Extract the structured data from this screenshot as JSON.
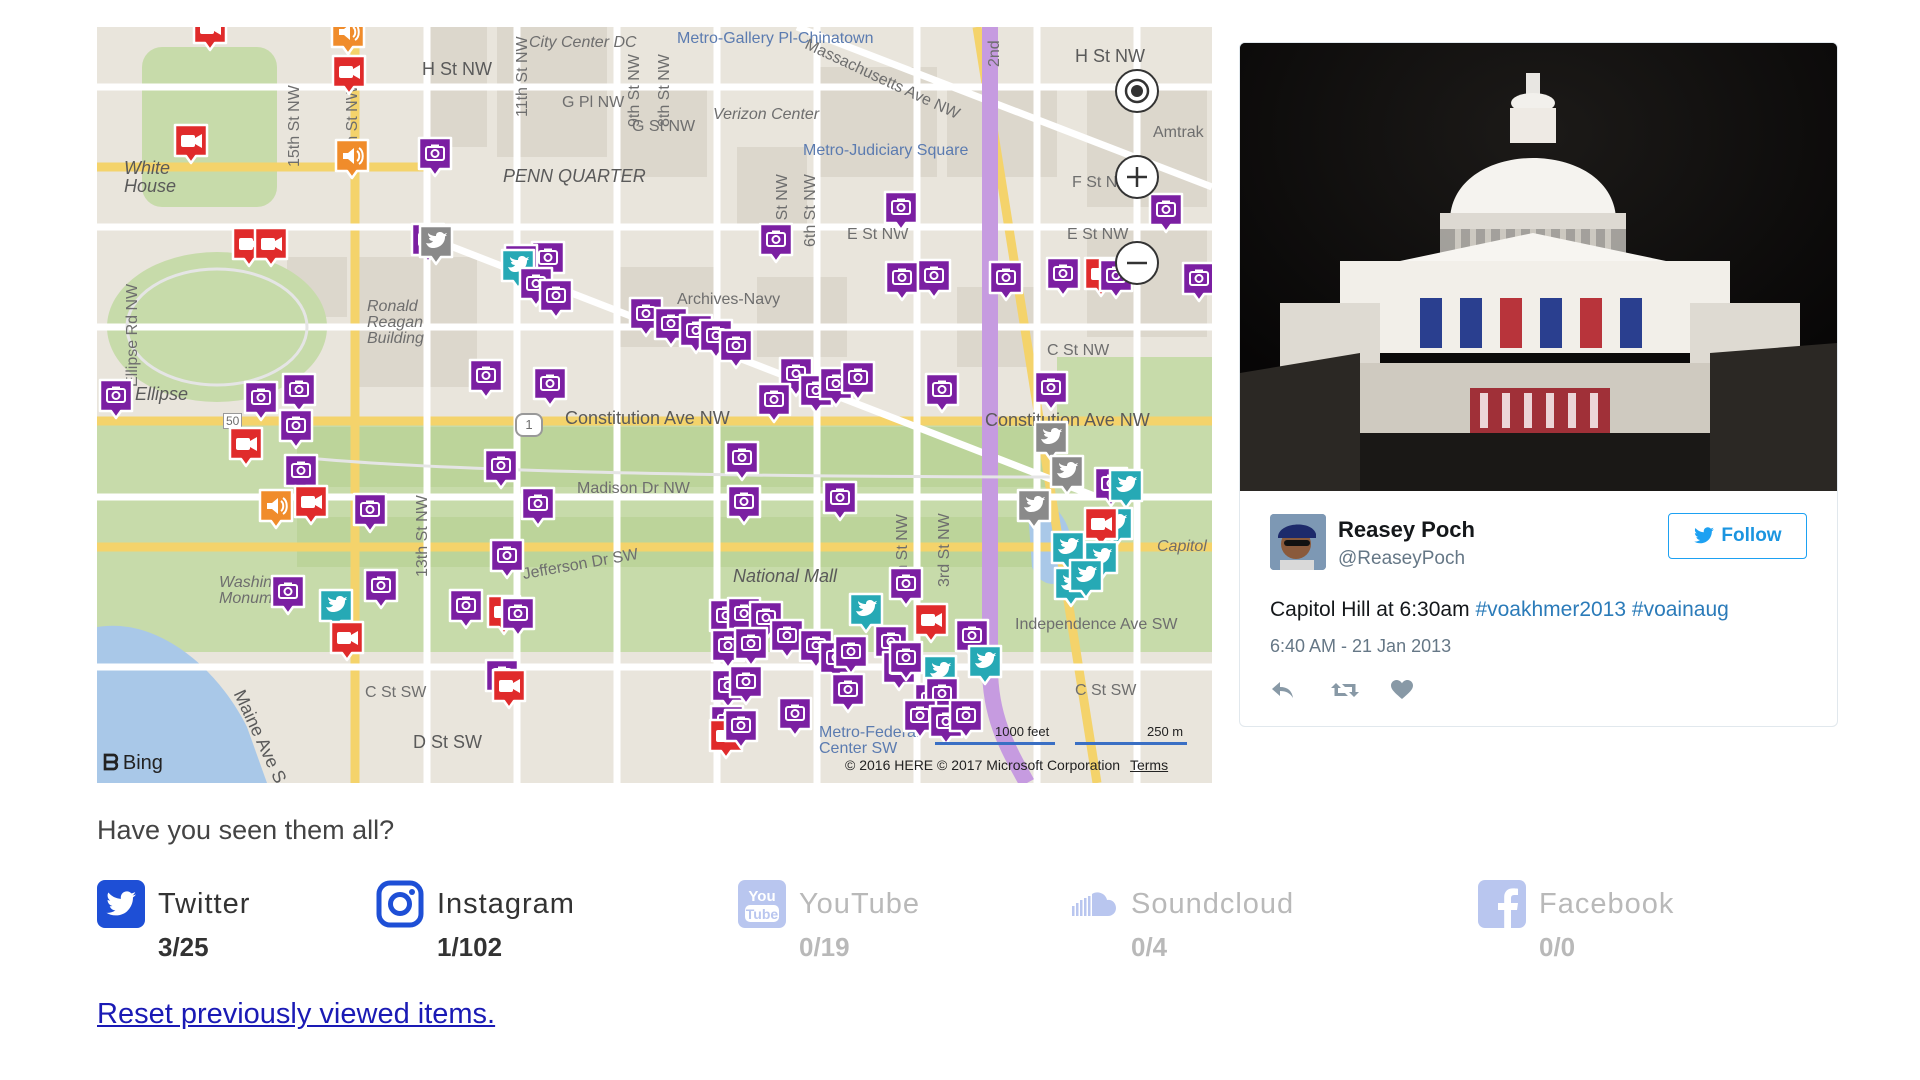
{
  "map": {
    "labels": {
      "city_center": "City Center DC",
      "metro_gallery": "Metro-Gallery Pl-Chinatown",
      "h_st_nw": "H St NW",
      "h_st_nw_right": "H St NW",
      "g_pl_nw": "G Pl NW",
      "g_st_nw": "G St NW",
      "verizon": "Verizon Center",
      "penn_quarter": "PENN QUARTER",
      "metro_judiciary": "Metro-Judiciary Square",
      "white_house": "White House",
      "f_st_nw": "F St NW",
      "e_st_nw": "E St NW",
      "e_st_nw_right": "E St NW",
      "ronald_reagan": "Ronald Reagan Building",
      "archives_navy": "Archives-Navy",
      "ellipse": "Ellipse",
      "constitution_ave": "Constitution Ave NW",
      "constitution_ave_right": "Constitution Ave NW",
      "c_st_nw": "C St NW",
      "madison_dr": "Madison Dr NW",
      "jefferson_dr": "Jefferson Dr SW",
      "national_mall": "National Mall",
      "independence_ave": "Independence Ave SW",
      "washington_monument": "Washington Monument",
      "c_st_sw": "C St SW",
      "c_st_sw_right": "C St SW",
      "d_st_sw": "D St SW",
      "maine_ave": "Maine Ave S",
      "metro_federal_center": "Metro-Federal Center SW",
      "capitol": "Capitol",
      "amtrak": "Amtrak",
      "ellipse_rd": "Ellipse Rd NW",
      "massachusetts": "Massachusetts Ave NW",
      "st_15th": "15th St NW",
      "st_14th": "14th St NW",
      "st_13th": "13th St NW",
      "st_11th": "11th St NW",
      "st_9th": "9th St NW",
      "st_8th": "8th St NW",
      "st_7th": "7th St NW",
      "st_6th": "6th St NW",
      "st_5th": "5th St NW",
      "st_4th": "4th St NW",
      "st_3rd": "3rd St NW",
      "st_2nd": "2nd",
      "route_1": "1",
      "route_50": "50"
    },
    "bing": "Bing",
    "scale_feet": "1000 feet",
    "scale_m": "250 m",
    "copyright": "© 2016 HERE © 2017 Microsoft Corporation",
    "terms": "Terms",
    "colors": {
      "instagram": "#7b1fa2",
      "twitter": "#26a9b5",
      "twitter_viewed": "#8a8a8a",
      "youtube": "#e02b2b",
      "soundcloud": "#f08c2b"
    }
  },
  "tweet": {
    "name": "Reasey Poch",
    "handle": "@ReaseyPoch",
    "follow_label": "Follow",
    "text_plain": "Capitol Hill at 6:30am",
    "hashtag1": "#voakhmer2013",
    "hashtag2": "#voainaug",
    "timestamp": "6:40 AM - 21 Jan 2013"
  },
  "question": "Have you seen them all?",
  "platforms": [
    {
      "name": "Twitter",
      "count": "3/25",
      "icon": "twitter-icon",
      "color": "#1e4fd6"
    },
    {
      "name": "Instagram",
      "count": "1/102",
      "icon": "instagram-icon",
      "color": "#1e4fd6"
    },
    {
      "name": "YouTube",
      "count": "0/19",
      "icon": "youtube-icon",
      "color": "#b9c6ef"
    },
    {
      "name": "Soundcloud",
      "count": "0/4",
      "icon": "soundcloud-icon",
      "color": "#b9c6ef"
    },
    {
      "name": "Facebook",
      "count": "0/0",
      "icon": "facebook-icon",
      "color": "#b9c6ef"
    }
  ],
  "reset_link": "Reset previously viewed items."
}
